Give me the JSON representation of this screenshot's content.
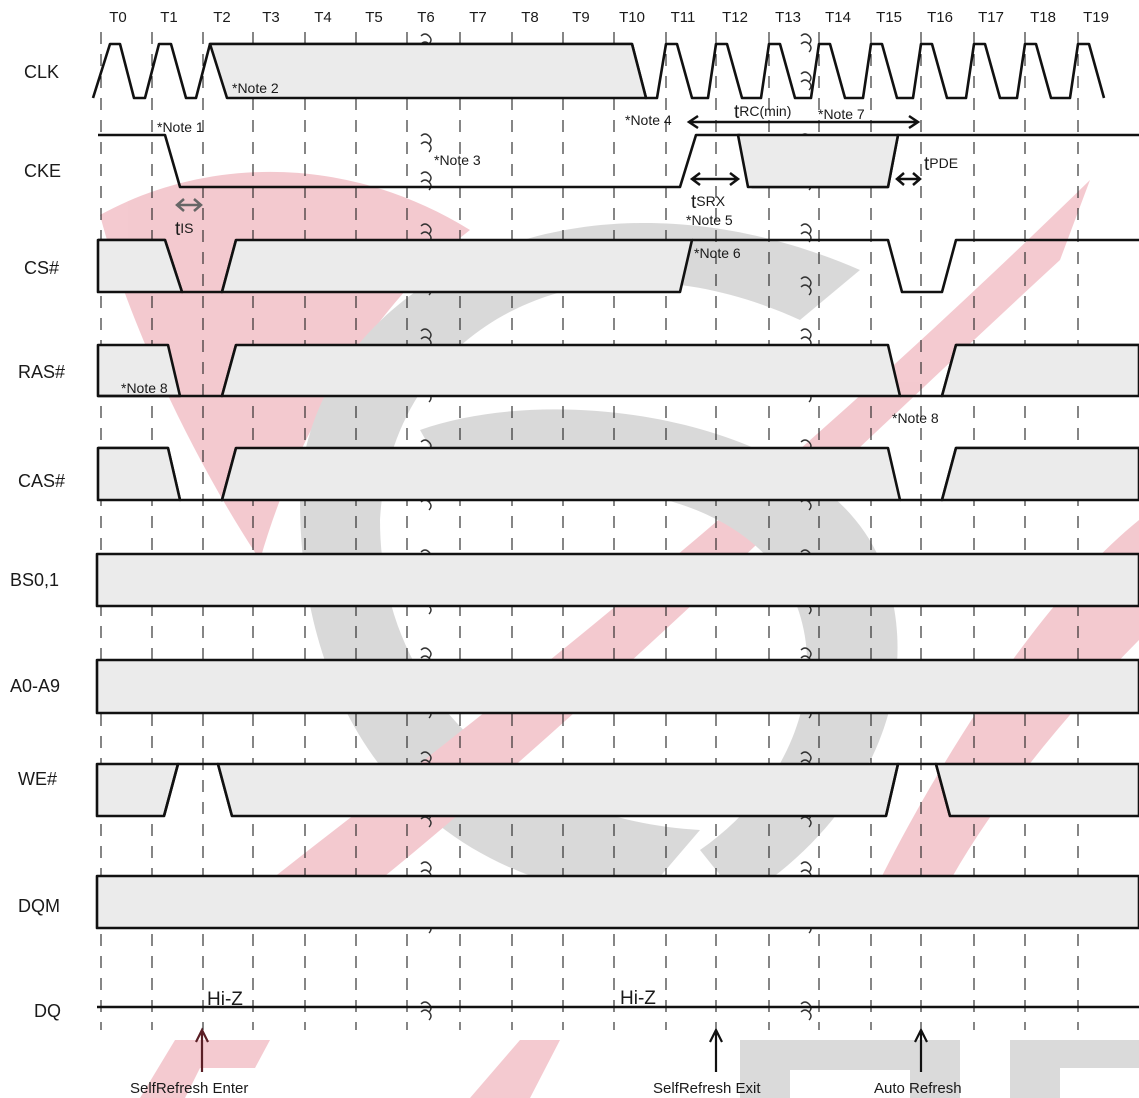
{
  "clock_labels": [
    "T0",
    "T1",
    "T2",
    "T3",
    "T4",
    "T5",
    "T6",
    "T7",
    "T8",
    "T9",
    "T10",
    "T11",
    "T12",
    "T13",
    "T14",
    "T15",
    "T16",
    "T17",
    "T18",
    "T19"
  ],
  "signals": {
    "clk": "CLK",
    "cke": "CKE",
    "cs": "CS#",
    "ras": "RAS#",
    "cas": "CAS#",
    "bs": "BS0,1",
    "addr": "A0-A9",
    "we": "WE#",
    "dqm": "DQM",
    "dq": "DQ"
  },
  "notes": {
    "note1": "*Note 1",
    "note2": "*Note 2",
    "note3": "*Note 3",
    "note4": "*Note 4",
    "note5": "*Note 5",
    "note6": "*Note 6",
    "note7": "*Note 7",
    "note8a": "*Note 8",
    "note8b": "*Note 8"
  },
  "timing": {
    "tis_main": "t",
    "tis_sub": "IS",
    "tsrx_main": "t",
    "tsrx_sub": "SRX",
    "trc_main": "t",
    "trc_sub": "RC(min)",
    "tpde_main": "t",
    "tpde_sub": "PDE"
  },
  "hiz": [
    "Hi-Z",
    "Hi-Z"
  ],
  "events": {
    "enter": "SelfRefresh Enter",
    "exit": "SelfRefresh Exit",
    "auto": "Auto Refresh"
  },
  "colors": {
    "bus_fill": "#ebebeb",
    "line": "#111111",
    "watermark_red": "#dc5a6e",
    "watermark_gray": "#8c8c8c"
  }
}
